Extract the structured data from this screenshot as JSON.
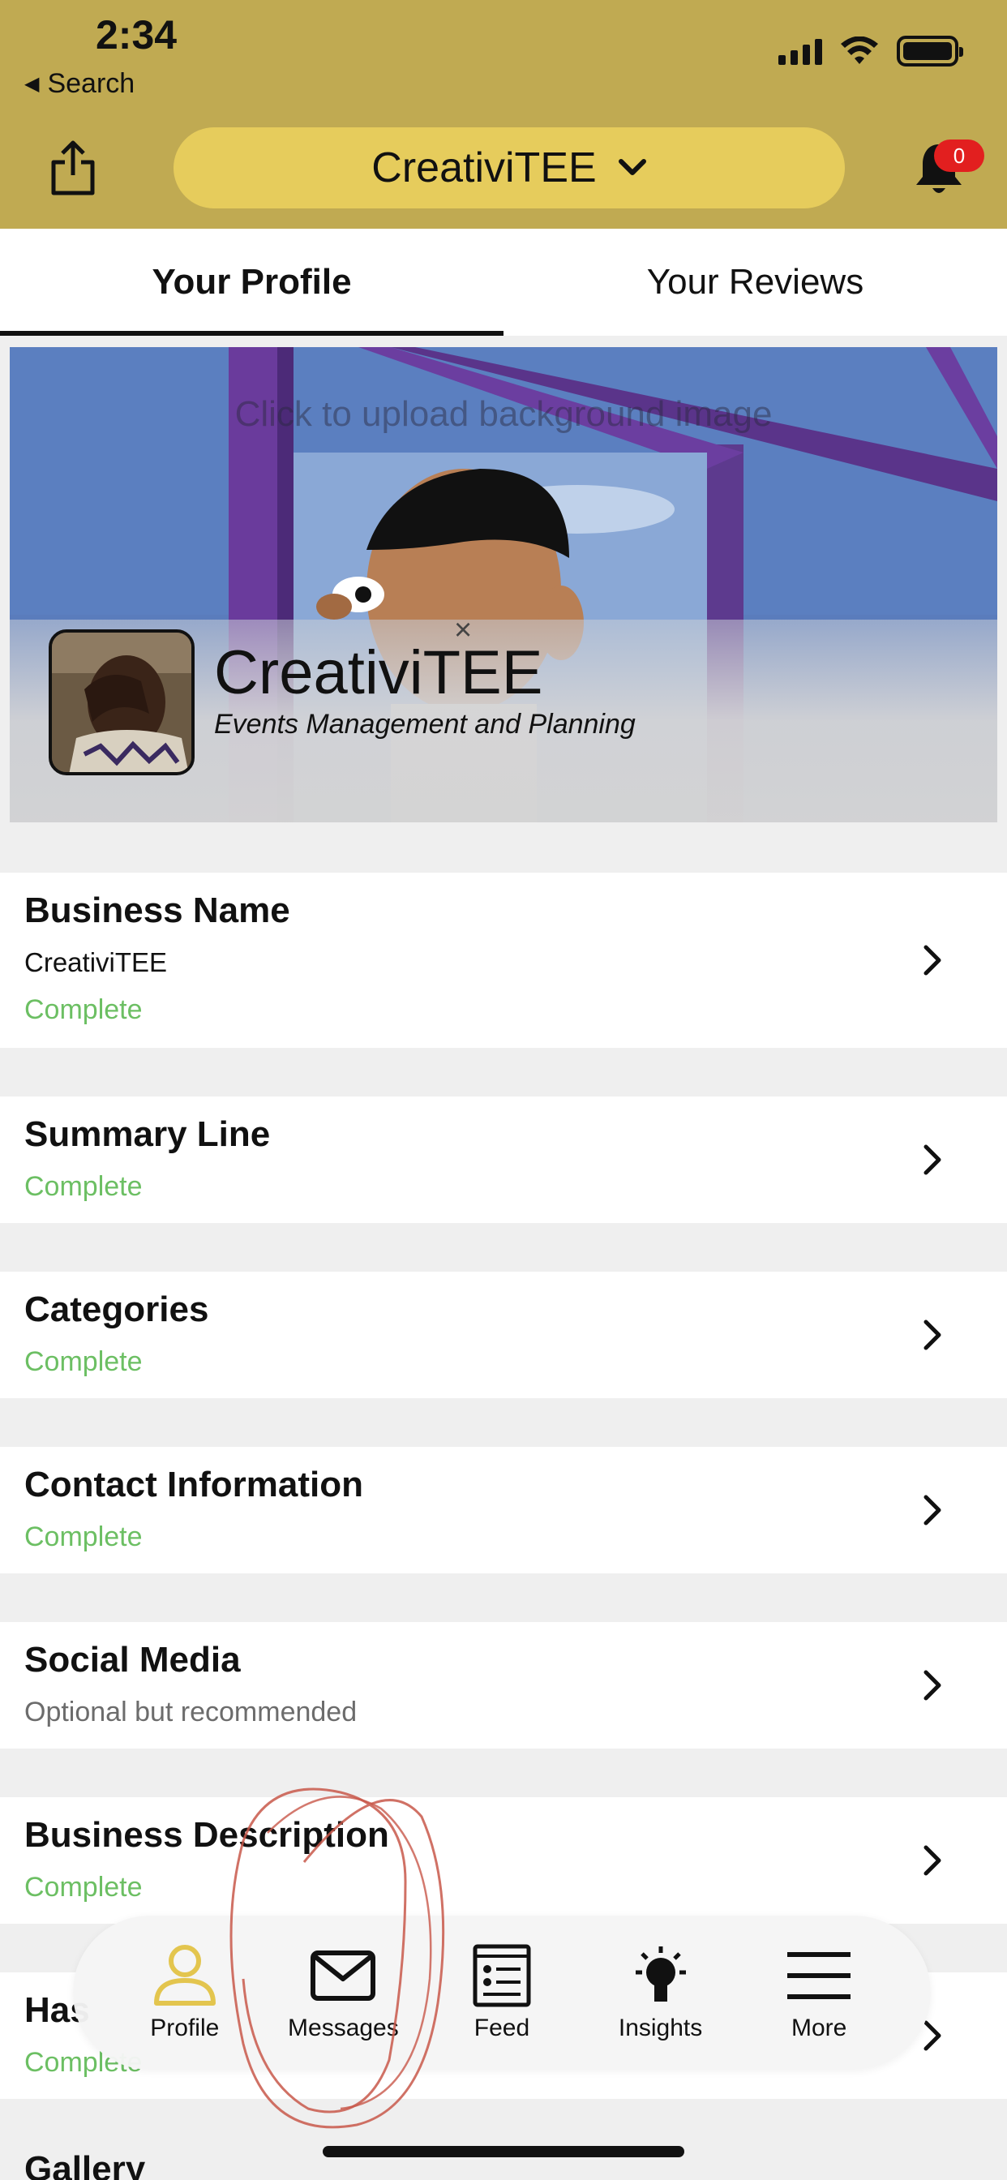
{
  "status_bar": {
    "time": "2:34",
    "back_label": "Search"
  },
  "header": {
    "business_selector": "CreativiTEE",
    "notification_count": "0",
    "accent_color": "#c0aa52",
    "selector_color": "#e6cc5c"
  },
  "tabs": [
    {
      "label": "Your Profile",
      "active": true
    },
    {
      "label": "Your Reviews",
      "active": false
    }
  ],
  "banner": {
    "upload_hint": "Click to upload background image",
    "close_glyph": "×",
    "name": "CreativiTEE",
    "tagline": "Events Management and Planning"
  },
  "profile_items": [
    {
      "title": "Business Name",
      "value": "CreativiTEE",
      "status": "Complete"
    },
    {
      "title": "Summary Line",
      "status": "Complete"
    },
    {
      "title": "Categories",
      "status": "Complete"
    },
    {
      "title": "Contact Information",
      "status": "Complete"
    },
    {
      "title": "Social Media",
      "status": "Optional but recommended"
    },
    {
      "title": "Business Description",
      "status": "Complete"
    },
    {
      "title": "Has",
      "status": "Complete"
    },
    {
      "title": "Gallery"
    }
  ],
  "status_colors": {
    "complete": "#6cbf63",
    "optional": "#6c6c6c"
  },
  "bottom_nav": [
    {
      "label": "Profile",
      "icon": "person-icon"
    },
    {
      "label": "Messages",
      "icon": "envelope-icon"
    },
    {
      "label": "Feed",
      "icon": "feed-icon"
    },
    {
      "label": "Insights",
      "icon": "lightbulb-icon"
    },
    {
      "label": "More",
      "icon": "menu-icon"
    }
  ]
}
